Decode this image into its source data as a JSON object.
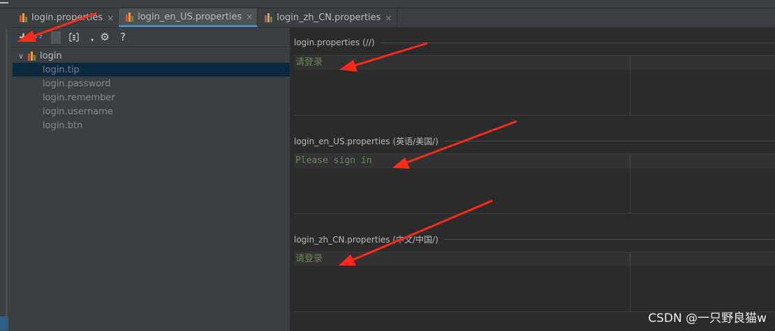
{
  "tabs": [
    {
      "label": "login.properties",
      "close": "×",
      "active": false
    },
    {
      "label": "login_en_US.properties",
      "close": "×",
      "active": true
    },
    {
      "label": "login_zh_CN.properties",
      "close": "×",
      "active": false
    }
  ],
  "toolbar": {
    "add": "+",
    "sort": "a z",
    "help": "?",
    "icons": [
      "plus-icon",
      "sort-alpha-icon",
      "structure-icon",
      "dropdown-arrow-icon",
      "gear-icon",
      "help-icon"
    ]
  },
  "tree": {
    "root": {
      "label": "login",
      "expanded": true
    },
    "items": [
      {
        "label": "login.tip",
        "selected": true
      },
      {
        "label": "login.password",
        "selected": false
      },
      {
        "label": "login.remember",
        "selected": false
      },
      {
        "label": "login.username",
        "selected": false
      },
      {
        "label": "login.btn",
        "selected": false
      }
    ]
  },
  "editors": [
    {
      "header": "login.properties (//)",
      "value": "请登录"
    },
    {
      "header": "login_en_US.properties (英语/美国/)",
      "value": "Please sign in"
    },
    {
      "header": "login_zh_CN.properties (中文/中国/)",
      "value": "请登录"
    }
  ],
  "watermark": "CSDN @一只野良猫w",
  "colors": {
    "accent": "#4a88c7",
    "value_green": "#6a8759",
    "annotation_red": "#ff2a1a"
  }
}
